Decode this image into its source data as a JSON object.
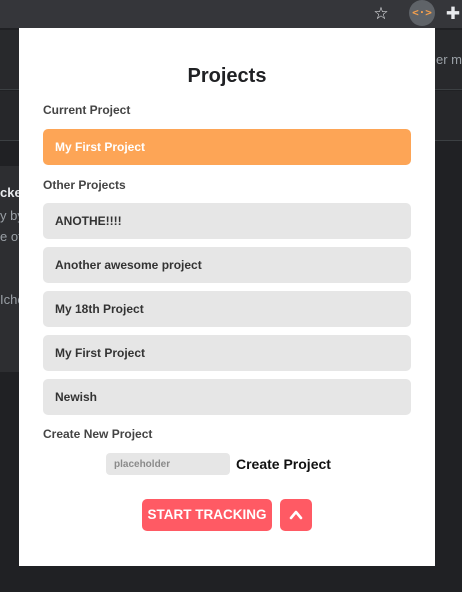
{
  "browser": {
    "star_icon": "☆",
    "extension_icon": "<·>",
    "puzzle_icon": "✚",
    "bg_texts": [
      "er mo",
      "cke",
      "y by",
      "e of",
      "Iche"
    ]
  },
  "popup": {
    "title": "Projects",
    "current_label": "Current Project",
    "current_project": "My First Project",
    "other_label": "Other Projects",
    "other_projects": [
      "ANOTHE!!!!",
      "Another awesome project",
      "My 18th Project",
      "My First Project",
      "Newish"
    ],
    "create_label": "Create New Project",
    "create_placeholder": "placeholder",
    "create_button": "Create Project",
    "start_button": "START TRACKING"
  },
  "colors": {
    "current_accent": "#fda556",
    "start_accent": "#ff5a64",
    "project_bg": "#e6e6e6"
  }
}
